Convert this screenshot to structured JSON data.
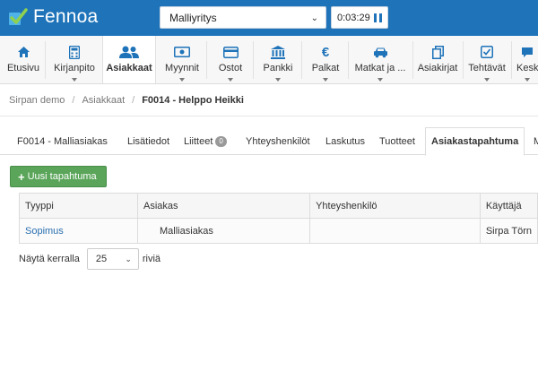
{
  "app": {
    "logo_text": "Fennoa"
  },
  "topbar": {
    "company": "Malliyritys",
    "timer": "0:03:29"
  },
  "nav": {
    "items": [
      {
        "label": "Etusivu",
        "icon": "home-icon"
      },
      {
        "label": "Kirjanpito",
        "icon": "calculator-icon"
      },
      {
        "label": "Asiakkaat",
        "icon": "users-icon",
        "active": true
      },
      {
        "label": "Myynnit",
        "icon": "money-icon"
      },
      {
        "label": "Ostot",
        "icon": "credit-card-icon"
      },
      {
        "label": "Pankki",
        "icon": "bank-icon"
      },
      {
        "label": "Palkat",
        "icon": "euro-icon"
      },
      {
        "label": "Matkat ja ...",
        "icon": "car-icon"
      },
      {
        "label": "Asiakirjat",
        "icon": "documents-icon"
      },
      {
        "label": "Tehtävät",
        "icon": "checkbox-icon"
      },
      {
        "label": "Kesk",
        "icon": "chat-icon"
      }
    ]
  },
  "breadcrumb": {
    "items": [
      "Sirpan demo",
      "Asiakkaat"
    ],
    "current": "F0014 - Helppo Heikki"
  },
  "tabs": [
    {
      "label": "F0014 -  Malliasiakas"
    },
    {
      "label": "Lisätiedot"
    },
    {
      "label": "Liitteet",
      "badge": "0"
    },
    {
      "label": "Yhteyshenkilöt"
    },
    {
      "label": "Laskutus"
    },
    {
      "label": "Tuotteet"
    },
    {
      "label": "Asiakastapahtuma",
      "active": true
    },
    {
      "label": "M"
    }
  ],
  "new_button": {
    "label": "Uusi tapahtuma"
  },
  "table": {
    "headers": [
      "Tyyppi",
      "Asiakas",
      "Yhteyshenkilö",
      "Käyttäjä"
    ],
    "rows": [
      [
        "Sopimus",
        "Malliasiakas",
        "",
        "Sirpa Törn"
      ]
    ]
  },
  "pager": {
    "prefix": "Näytä kerralla",
    "value": "25",
    "suffix": "riviä"
  },
  "colors": {
    "topbar": "#1e73b9",
    "button_green": "#5aa55a",
    "link": "#2a6fb0"
  }
}
